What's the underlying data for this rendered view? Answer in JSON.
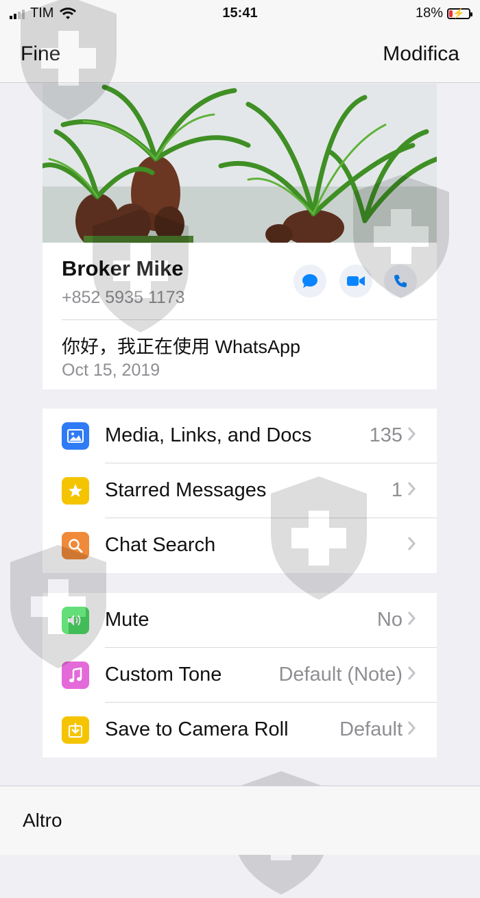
{
  "status_bar": {
    "carrier": "TIM",
    "time": "15:41",
    "battery_percent": "18%",
    "battery_level": 0.18,
    "signal_bars": 2
  },
  "nav": {
    "back_label": "Fine",
    "edit_label": "Modifica"
  },
  "contact": {
    "name": "Broker Mike",
    "phone": "+852 5935 1173",
    "about": "你好，我正在使用 WhatsApp",
    "about_date": "Oct 15, 2019"
  },
  "group1": [
    {
      "label": "Media, Links, and Docs",
      "value": "135",
      "icon": "photo-icon",
      "color": "#2f7bf5"
    },
    {
      "label": "Starred Messages",
      "value": "1",
      "icon": "star-icon",
      "color": "#f5c400"
    },
    {
      "label": "Chat Search",
      "value": "",
      "icon": "search-icon",
      "color": "#ef8a3a"
    }
  ],
  "group2": [
    {
      "label": "Mute",
      "value": "No",
      "icon": "speaker-icon",
      "color": "#4cd964"
    },
    {
      "label": "Custom Tone",
      "value": "Default (Note)",
      "icon": "music-note-icon",
      "color": "#e46ad9"
    },
    {
      "label": "Save to Camera Roll",
      "value": "Default",
      "icon": "download-icon",
      "color": "#f5c400"
    }
  ],
  "tabbar": {
    "more_label": "Altro"
  },
  "colors": {
    "accent": "#0a84ff",
    "background": "#efeff4"
  }
}
